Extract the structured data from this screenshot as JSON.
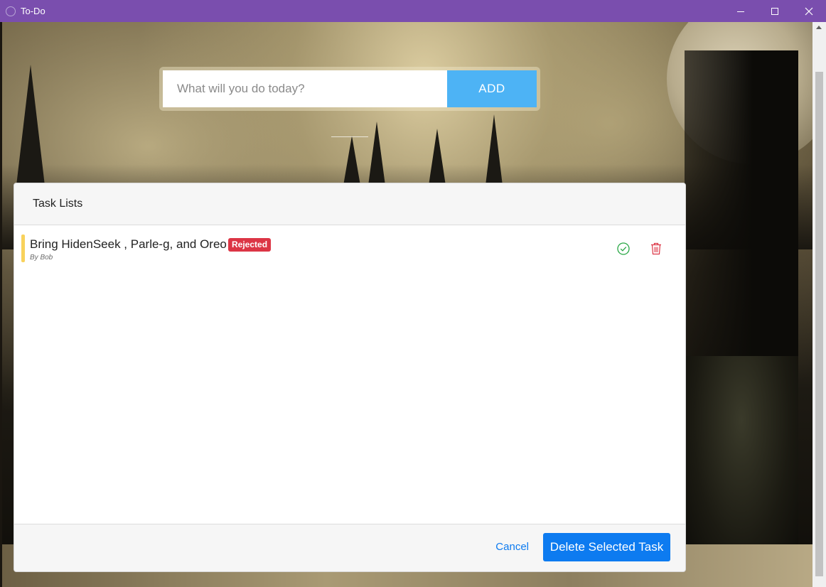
{
  "window": {
    "title": "To-Do",
    "app_icon": "todo-app-icon",
    "controls": [
      "minimize-icon",
      "maximize-icon",
      "close-icon"
    ]
  },
  "add_form": {
    "placeholder": "What will you do today?",
    "value": "",
    "button_label": "ADD"
  },
  "modal": {
    "title": "Task Lists",
    "tasks": [
      {
        "text": "Bring HidenSeek , Parle-g, and Oreo",
        "status": "Rejected",
        "author": "By Bob",
        "accent_color": "#f8d25c",
        "status_color": "#dc3545",
        "actions": [
          "check-circle-icon",
          "trash-icon"
        ]
      }
    ],
    "footer": {
      "cancel_label": "Cancel",
      "delete_label": "Delete Selected Task"
    }
  },
  "colors": {
    "titlebar": "#7a4eae",
    "add_button": "#4db3f5",
    "primary": "#0d7bf0",
    "complete": "#28a745",
    "delete": "#dc3545"
  }
}
